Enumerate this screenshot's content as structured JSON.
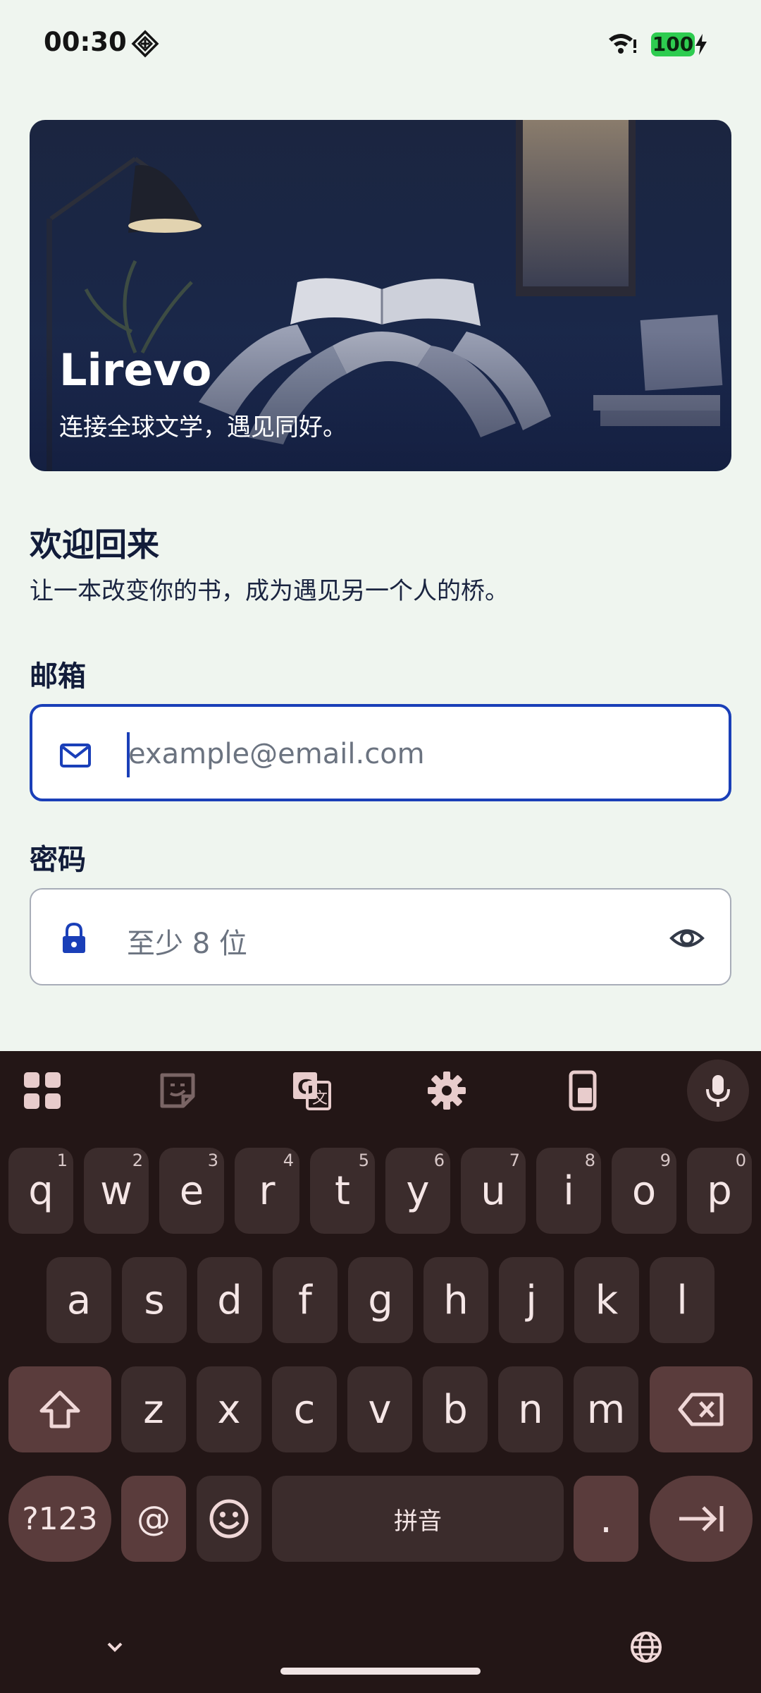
{
  "status": {
    "time": "00:30",
    "battery": "100"
  },
  "hero": {
    "title": "Lirevo",
    "subtitle": "连接全球文学，遇见同好。"
  },
  "welcome": {
    "title": "欢迎回来",
    "subtitle": "让一本改变你的书，成为遇见另一个人的桥。"
  },
  "form": {
    "email_label": "邮箱",
    "email_placeholder": "example@email.com",
    "password_label": "密码",
    "password_placeholder": "至少 8 位"
  },
  "keyboard": {
    "row1": [
      {
        "key": "q",
        "hint": "1"
      },
      {
        "key": "w",
        "hint": "2"
      },
      {
        "key": "e",
        "hint": "3"
      },
      {
        "key": "r",
        "hint": "4"
      },
      {
        "key": "t",
        "hint": "5"
      },
      {
        "key": "y",
        "hint": "6"
      },
      {
        "key": "u",
        "hint": "7"
      },
      {
        "key": "i",
        "hint": "8"
      },
      {
        "key": "o",
        "hint": "9"
      },
      {
        "key": "p",
        "hint": "0"
      }
    ],
    "row2": [
      "a",
      "s",
      "d",
      "f",
      "g",
      "h",
      "j",
      "k",
      "l"
    ],
    "row3": [
      "z",
      "x",
      "c",
      "v",
      "b",
      "n",
      "m"
    ],
    "symbols_key": "?123",
    "at_key": "@",
    "space_key": "拼音",
    "period_key": "."
  }
}
